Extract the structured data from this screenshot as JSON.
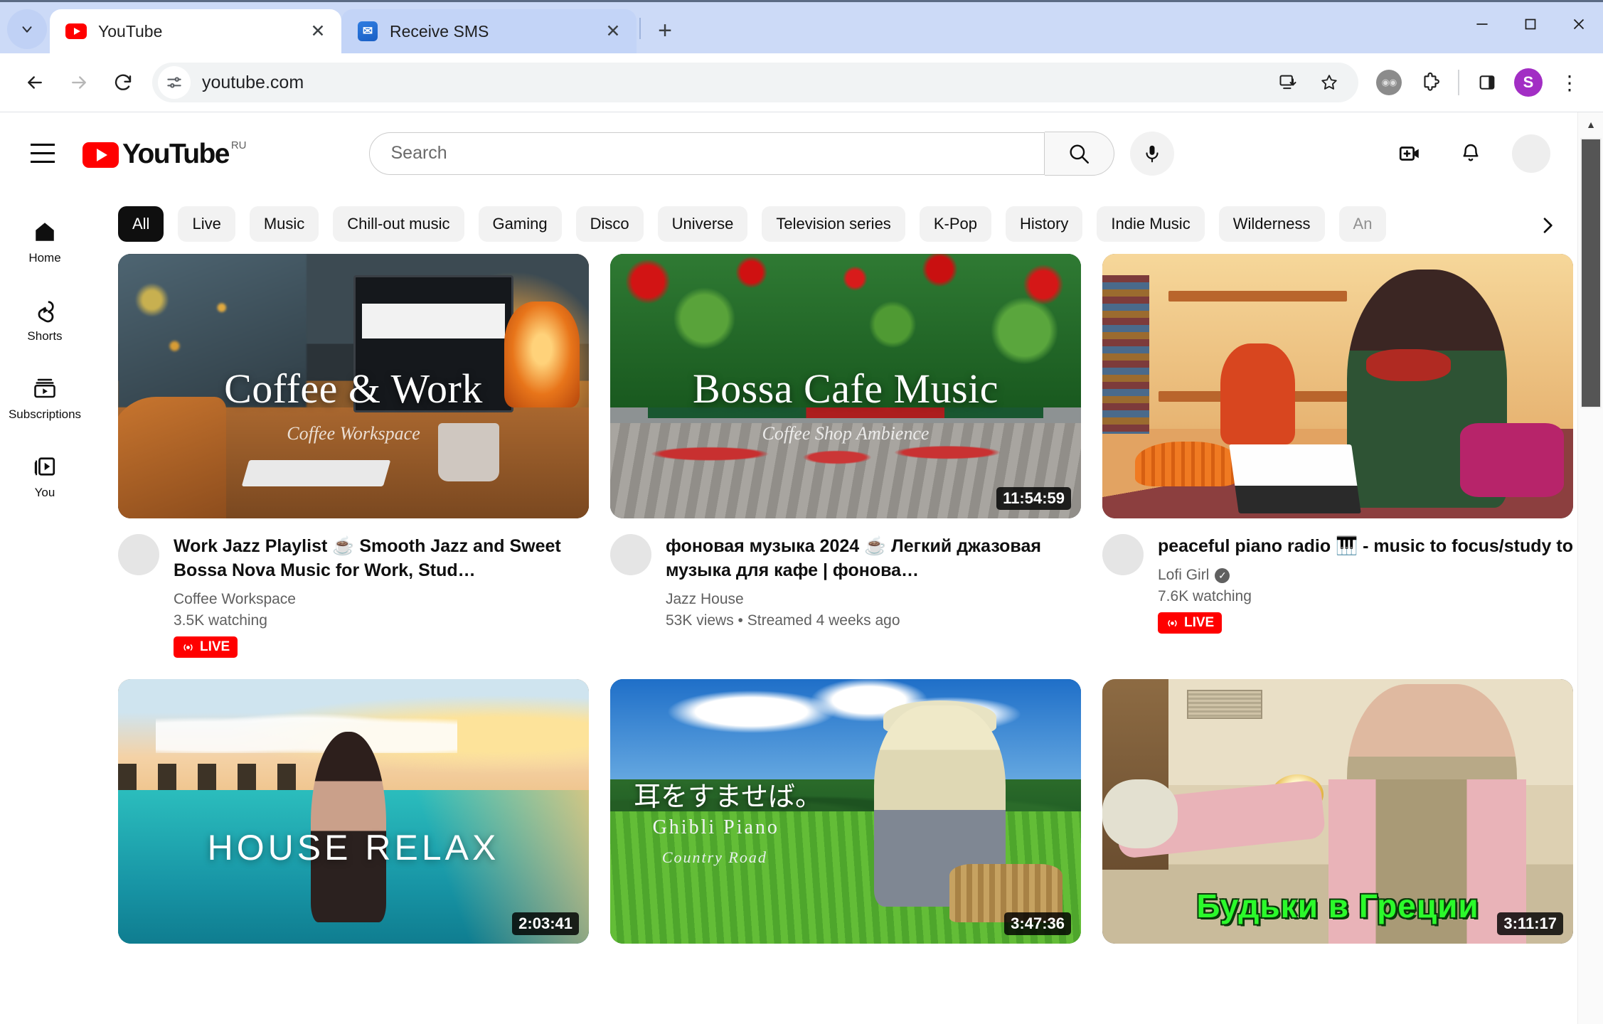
{
  "browser": {
    "tabs": [
      {
        "title": "YouTube",
        "favicon": "youtube-icon",
        "active": true,
        "close_label": "✕"
      },
      {
        "title": "Receive SMS",
        "favicon": "sms-icon",
        "active": false,
        "close_label": "✕"
      }
    ],
    "new_tab_label": "+",
    "tab_list_label": "⌄",
    "window_controls": {
      "minimize": "—",
      "maximize": "□",
      "close": "✕"
    },
    "nav": {
      "back": "←",
      "forward": "→",
      "reload": "↻"
    },
    "omnibox": {
      "url": "youtube.com",
      "site_info_icon": "site-settings-icon"
    },
    "toolbar_icons": [
      "install-app-icon",
      "bookmark-star-icon",
      "extension-adblock-icon",
      "extensions-puzzle-icon",
      "side-panel-icon"
    ],
    "profile_initial": "S",
    "menu_label": "⋮"
  },
  "youtube": {
    "logo_text": "YouTube",
    "country_code": "RU",
    "guide_button": "guide-menu-icon",
    "search": {
      "placeholder": "Search",
      "value": "",
      "button_icon": "search-icon",
      "mic_icon": "microphone-icon"
    },
    "header_icons": [
      "create-video-icon",
      "notifications-bell-icon",
      "account-avatar"
    ],
    "sidebar": [
      {
        "label": "Home",
        "icon": "home-icon",
        "active": true
      },
      {
        "label": "Shorts",
        "icon": "shorts-icon",
        "active": false
      },
      {
        "label": "Subscriptions",
        "icon": "subscriptions-icon",
        "active": false
      },
      {
        "label": "You",
        "icon": "you-library-icon",
        "active": false
      }
    ],
    "chips": [
      {
        "label": "All",
        "selected": true
      },
      {
        "label": "Live",
        "selected": false
      },
      {
        "label": "Music",
        "selected": false
      },
      {
        "label": "Chill-out music",
        "selected": false
      },
      {
        "label": "Gaming",
        "selected": false
      },
      {
        "label": "Disco",
        "selected": false
      },
      {
        "label": "Universe",
        "selected": false
      },
      {
        "label": "Television series",
        "selected": false
      },
      {
        "label": "K-Pop",
        "selected": false
      },
      {
        "label": "History",
        "selected": false
      },
      {
        "label": "Indie Music",
        "selected": false
      },
      {
        "label": "Wilderness",
        "selected": false
      },
      {
        "label": "An",
        "selected": false,
        "clipped": true
      }
    ],
    "chips_next_label": "›",
    "videos": [
      {
        "thumb_title": "Coffee & Work",
        "thumb_subtitle": "Coffee Workspace",
        "title": "Work Jazz Playlist ☕ Smooth Jazz and Sweet Bossa Nova Music for Work, Stud…",
        "channel": "Coffee Workspace",
        "verified": false,
        "stats": "3.5K watching",
        "duration": "",
        "live": true,
        "live_label": "LIVE"
      },
      {
        "thumb_title": "Bossa Cafe Music",
        "thumb_subtitle": "Coffee Shop Ambience",
        "title": "фоновая музыка 2024 ☕ Легкий джазовая музыка для кафе | фонова…",
        "channel": "Jazz House",
        "verified": false,
        "stats": "53K views • Streamed 4 weeks ago",
        "duration": "11:54:59",
        "live": false,
        "live_label": ""
      },
      {
        "thumb_title": "",
        "thumb_subtitle": "",
        "title": "peaceful piano radio 🎹 - music to focus/study to",
        "channel": "Lofi Girl",
        "verified": true,
        "stats": "7.6K watching",
        "duration": "",
        "live": true,
        "live_label": "LIVE"
      },
      {
        "thumb_title": "HOUSE RELAX",
        "thumb_subtitle": "",
        "title": "",
        "channel": "",
        "verified": false,
        "stats": "",
        "duration": "2:03:41",
        "live": false,
        "live_label": ""
      },
      {
        "thumb_title": "耳をすませば。",
        "thumb_subtitle": "Ghibli Piano",
        "thumb_subtitle2": "Country Road",
        "title": "",
        "channel": "",
        "verified": false,
        "stats": "",
        "duration": "3:47:36",
        "live": false,
        "live_label": ""
      },
      {
        "thumb_title": "Будьки в Греции",
        "thumb_subtitle": "",
        "title": "",
        "channel": "",
        "verified": false,
        "stats": "",
        "duration": "3:11:17",
        "live": false,
        "live_label": ""
      }
    ]
  },
  "colors": {
    "youtube_red": "#ff0000",
    "chrome_tabstrip": "#ccdaf7",
    "chip_bg": "#f2f2f2",
    "chip_selected_bg": "#0f0f0f",
    "profile_purple": "#a22ec4",
    "meta_grey": "#606060"
  }
}
